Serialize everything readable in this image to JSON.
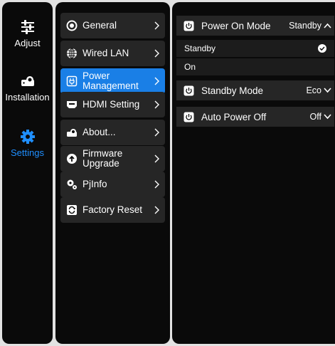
{
  "sidebar": {
    "items": [
      {
        "label": "Adjust",
        "icon": "sliders-icon",
        "active": false
      },
      {
        "label": "Installation",
        "icon": "projector-icon",
        "active": false
      },
      {
        "label": "Settings",
        "icon": "gear-icon",
        "active": true
      }
    ]
  },
  "menu": {
    "items": [
      {
        "label": "General",
        "icon": "target-icon"
      },
      {
        "label": "Wired LAN",
        "icon": "globe-icon"
      },
      {
        "label": "Power Management",
        "icon": "power-plug-icon",
        "active": true
      },
      {
        "label": "HDMI Setting",
        "icon": "hdmi-icon"
      },
      {
        "label": "About...",
        "icon": "projector-info-icon"
      },
      {
        "label": "Firmware Upgrade",
        "icon": "upload-icon"
      },
      {
        "label": "PjInfo",
        "icon": "gears-icon"
      },
      {
        "label": "Factory Reset",
        "icon": "reset-icon"
      }
    ]
  },
  "detail": {
    "power_on_mode": {
      "label": "Power On Mode",
      "value": "Standby",
      "expanded": true,
      "options": [
        {
          "label": "Standby",
          "selected": true
        },
        {
          "label": "On",
          "selected": false
        }
      ]
    },
    "standby_mode": {
      "label": "Standby Mode",
      "value": "Eco"
    },
    "auto_power_off": {
      "label": "Auto Power Off",
      "value": "Off"
    }
  },
  "colors": {
    "accent": "#1a7fe6",
    "active_text": "#1f8fff",
    "panel": "#0a0a0a",
    "row": "#262626",
    "frame": "#e2e2e2"
  }
}
